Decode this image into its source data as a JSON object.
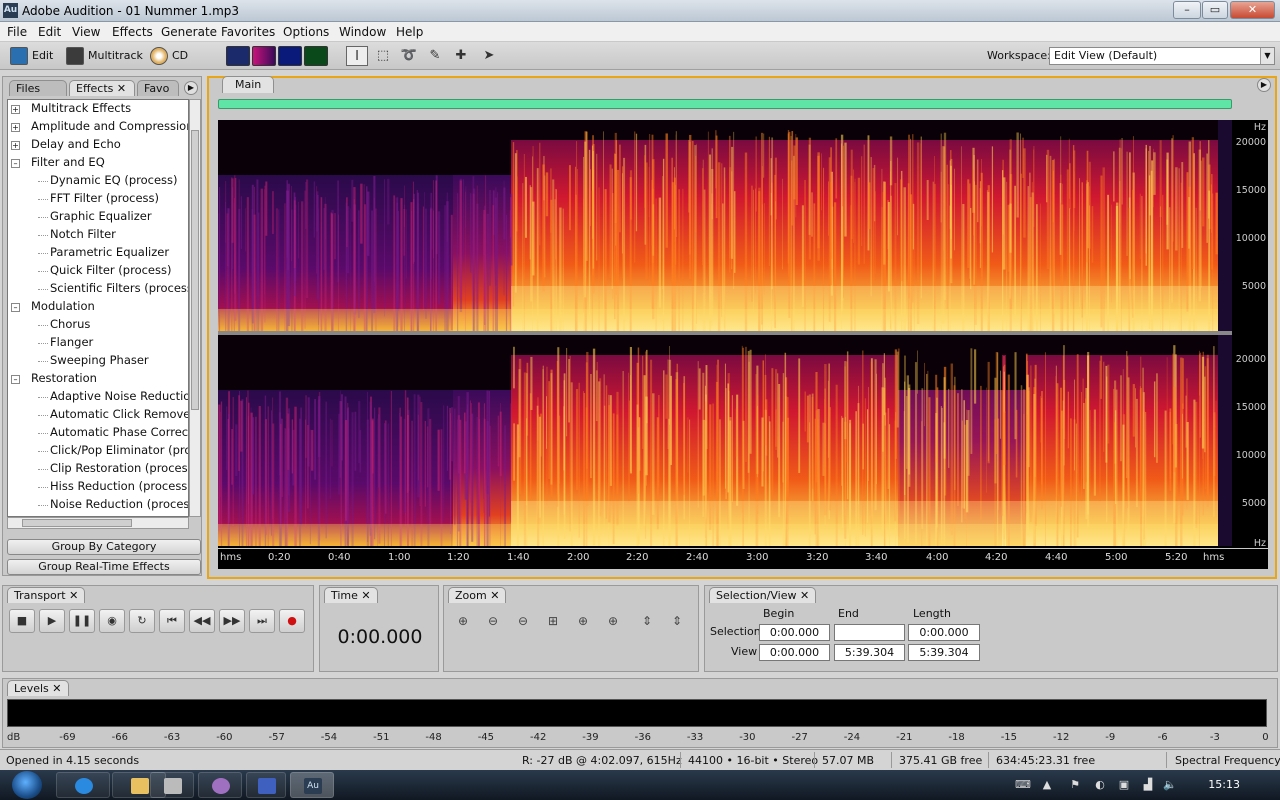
{
  "window": {
    "app_icon": "Au",
    "title": "Adobe Audition - 01 Nummer 1.mp3",
    "minimize": "–",
    "maximize": "▭",
    "close": "✕"
  },
  "menu": [
    "File",
    "Edit",
    "View",
    "Effects",
    "Generate",
    "Favorites",
    "Options",
    "Window",
    "Help"
  ],
  "toolbar": {
    "edit_label": "Edit",
    "multitrack_label": "Multitrack",
    "cd_label": "CD",
    "workspace_label": "Workspace:",
    "workspace_value": "Edit View (Default)"
  },
  "left_panel": {
    "tabs": [
      "Files",
      "Effects",
      "Favo"
    ],
    "tree": [
      {
        "label": "Multitrack Effects",
        "level": 0,
        "expander": "+"
      },
      {
        "label": "Amplitude and Compression",
        "level": 0,
        "expander": "+"
      },
      {
        "label": "Delay and Echo",
        "level": 0,
        "expander": "+"
      },
      {
        "label": "Filter and EQ",
        "level": 0,
        "expander": "–"
      },
      {
        "label": "Dynamic EQ (process)",
        "level": 1
      },
      {
        "label": "FFT Filter (process)",
        "level": 1
      },
      {
        "label": "Graphic Equalizer",
        "level": 1
      },
      {
        "label": "Notch Filter",
        "level": 1
      },
      {
        "label": "Parametric Equalizer",
        "level": 1
      },
      {
        "label": "Quick Filter (process)",
        "level": 1
      },
      {
        "label": "Scientific Filters (process)",
        "level": 1
      },
      {
        "label": "Modulation",
        "level": 0,
        "expander": "–"
      },
      {
        "label": "Chorus",
        "level": 1
      },
      {
        "label": "Flanger",
        "level": 1
      },
      {
        "label": "Sweeping Phaser",
        "level": 1
      },
      {
        "label": "Restoration",
        "level": 0,
        "expander": "–"
      },
      {
        "label": "Adaptive Noise Reduction",
        "level": 1
      },
      {
        "label": "Automatic Click Remover",
        "level": 1
      },
      {
        "label": "Automatic Phase Correcti",
        "level": 1
      },
      {
        "label": "Click/Pop Eliminator (proc",
        "level": 1
      },
      {
        "label": "Clip Restoration (process)",
        "level": 1
      },
      {
        "label": "Hiss Reduction (process)",
        "level": 1
      },
      {
        "label": "Noise Reduction (process)",
        "level": 1
      }
    ],
    "group_by_category": "Group By Category",
    "group_realtime": "Group Real-Time Effects"
  },
  "main": {
    "tab": "Main",
    "freq_unit": "Hz",
    "freq_labels": [
      "20000",
      "15000",
      "10000",
      "5000"
    ],
    "time_labels": [
      "hms",
      "0:20",
      "0:40",
      "1:00",
      "1:20",
      "1:40",
      "2:00",
      "2:20",
      "2:40",
      "3:00",
      "3:20",
      "3:40",
      "4:00",
      "4:20",
      "4:40",
      "5:00",
      "5:20",
      "hms"
    ]
  },
  "transport": {
    "tab": "Transport"
  },
  "time_panel": {
    "tab": "Time",
    "value": "0:00.000"
  },
  "zoom_panel": {
    "tab": "Zoom"
  },
  "selection_view": {
    "tab": "Selection/View",
    "col_begin": "Begin",
    "col_end": "End",
    "col_length": "Length",
    "row_selection": "Selection",
    "row_view": "View",
    "selection_begin": "0:00.000",
    "selection_end": "",
    "selection_length": "0:00.000",
    "view_begin": "0:00.000",
    "view_end": "5:39.304",
    "view_length": "5:39.304"
  },
  "levels": {
    "tab": "Levels",
    "db_labels": [
      "dB",
      "-69",
      "-66",
      "-63",
      "-60",
      "-57",
      "-54",
      "-51",
      "-48",
      "-45",
      "-42",
      "-39",
      "-36",
      "-33",
      "-30",
      "-27",
      "-24",
      "-21",
      "-18",
      "-15",
      "-12",
      "-9",
      "-6",
      "-3",
      "0"
    ]
  },
  "status": {
    "opened": "Opened in 4.15 seconds",
    "cursor": "R: -27 dB @  4:02.097, 615Hz",
    "format": "44100 • 16-bit • Stereo",
    "size": "57.07 MB",
    "disk_free": "375.41 GB free",
    "time_free": "634:45:23.31 free",
    "view_mode": "Spectral Frequency"
  },
  "taskbar": {
    "clock": "15:13",
    "active_app": "Au"
  },
  "colors": {
    "accent_border": "#e8a516",
    "overview_bar": "#5fe6a6"
  }
}
